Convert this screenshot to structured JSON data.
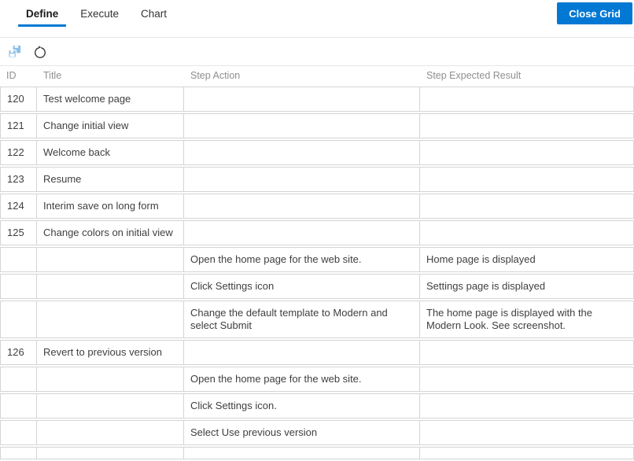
{
  "tabs": {
    "items": [
      {
        "label": "Define",
        "active": true
      },
      {
        "label": "Execute",
        "active": false
      },
      {
        "label": "Chart",
        "active": false
      }
    ]
  },
  "close_button_label": "Close Grid",
  "toolbar": {
    "icons": [
      {
        "name": "save-all-icon",
        "color": "#8cc0e8"
      },
      {
        "name": "refresh-icon",
        "color": "#333333"
      }
    ]
  },
  "colors": {
    "accent": "#0078d4",
    "row_header_bg": "#ebebeb",
    "disabled_cell_bg": "#f5f5f5",
    "border": "#d4d4d4",
    "header_text": "#8f8f8f"
  },
  "grid": {
    "columns": [
      "ID",
      "Title",
      "Step Action",
      "Step Expected Result"
    ],
    "rows": [
      {
        "kind": "case",
        "id": "120",
        "title": "Test welcome page",
        "action": "",
        "expected": ""
      },
      {
        "kind": "case",
        "id": "121",
        "title": "Change initial view",
        "action": "",
        "expected": ""
      },
      {
        "kind": "case",
        "id": "122",
        "title": "Welcome back",
        "action": "",
        "expected": ""
      },
      {
        "kind": "case",
        "id": "123",
        "title": "Resume",
        "action": "",
        "expected": ""
      },
      {
        "kind": "case",
        "id": "124",
        "title": "Interim save on long form",
        "action": "",
        "expected": ""
      },
      {
        "kind": "case",
        "id": "125",
        "title": "Change colors on initial view",
        "action": "",
        "expected": ""
      },
      {
        "kind": "step",
        "id": "",
        "title": "",
        "action": "Open the home page for the web site.",
        "expected": "Home page is displayed"
      },
      {
        "kind": "step",
        "id": "",
        "title": "",
        "action": "Click Settings icon",
        "expected": "Settings page is displayed"
      },
      {
        "kind": "step",
        "id": "",
        "title": "",
        "action": "Change the default template to Modern and select Submit",
        "expected": "The home page is displayed with the Modern Look. See screenshot."
      },
      {
        "kind": "case",
        "id": "126",
        "title": "Revert to previous version",
        "action": "",
        "expected": ""
      },
      {
        "kind": "step",
        "id": "",
        "title": "",
        "action": "Open the home page for the web site.",
        "expected": ""
      },
      {
        "kind": "step",
        "id": "",
        "title": "",
        "action": "Click Settings icon.",
        "expected": ""
      },
      {
        "kind": "step",
        "id": "",
        "title": "",
        "action": "Select Use previous version",
        "expected": ""
      },
      {
        "kind": "step",
        "id": "",
        "title": "",
        "action": "",
        "expected": ""
      }
    ]
  }
}
